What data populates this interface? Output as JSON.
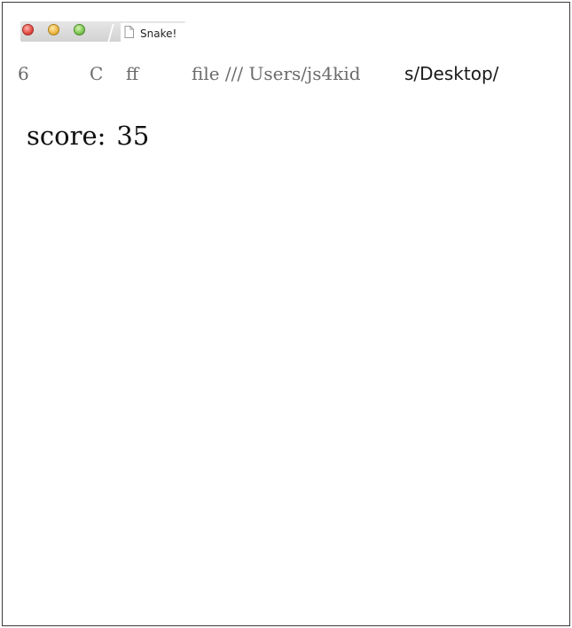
{
  "window": {
    "tab_title": "Snake!",
    "controls": [
      "close-button",
      "minimize-button",
      "zoom-button"
    ]
  },
  "toolbar": {
    "back_label": "6",
    "reload_label": "C",
    "ff_label": "ff",
    "url_prefix": "file ///  Users/js4kid",
    "url_suffix": "s/Desktop/"
  },
  "game": {
    "score_label": "score:",
    "score_value": "35"
  }
}
